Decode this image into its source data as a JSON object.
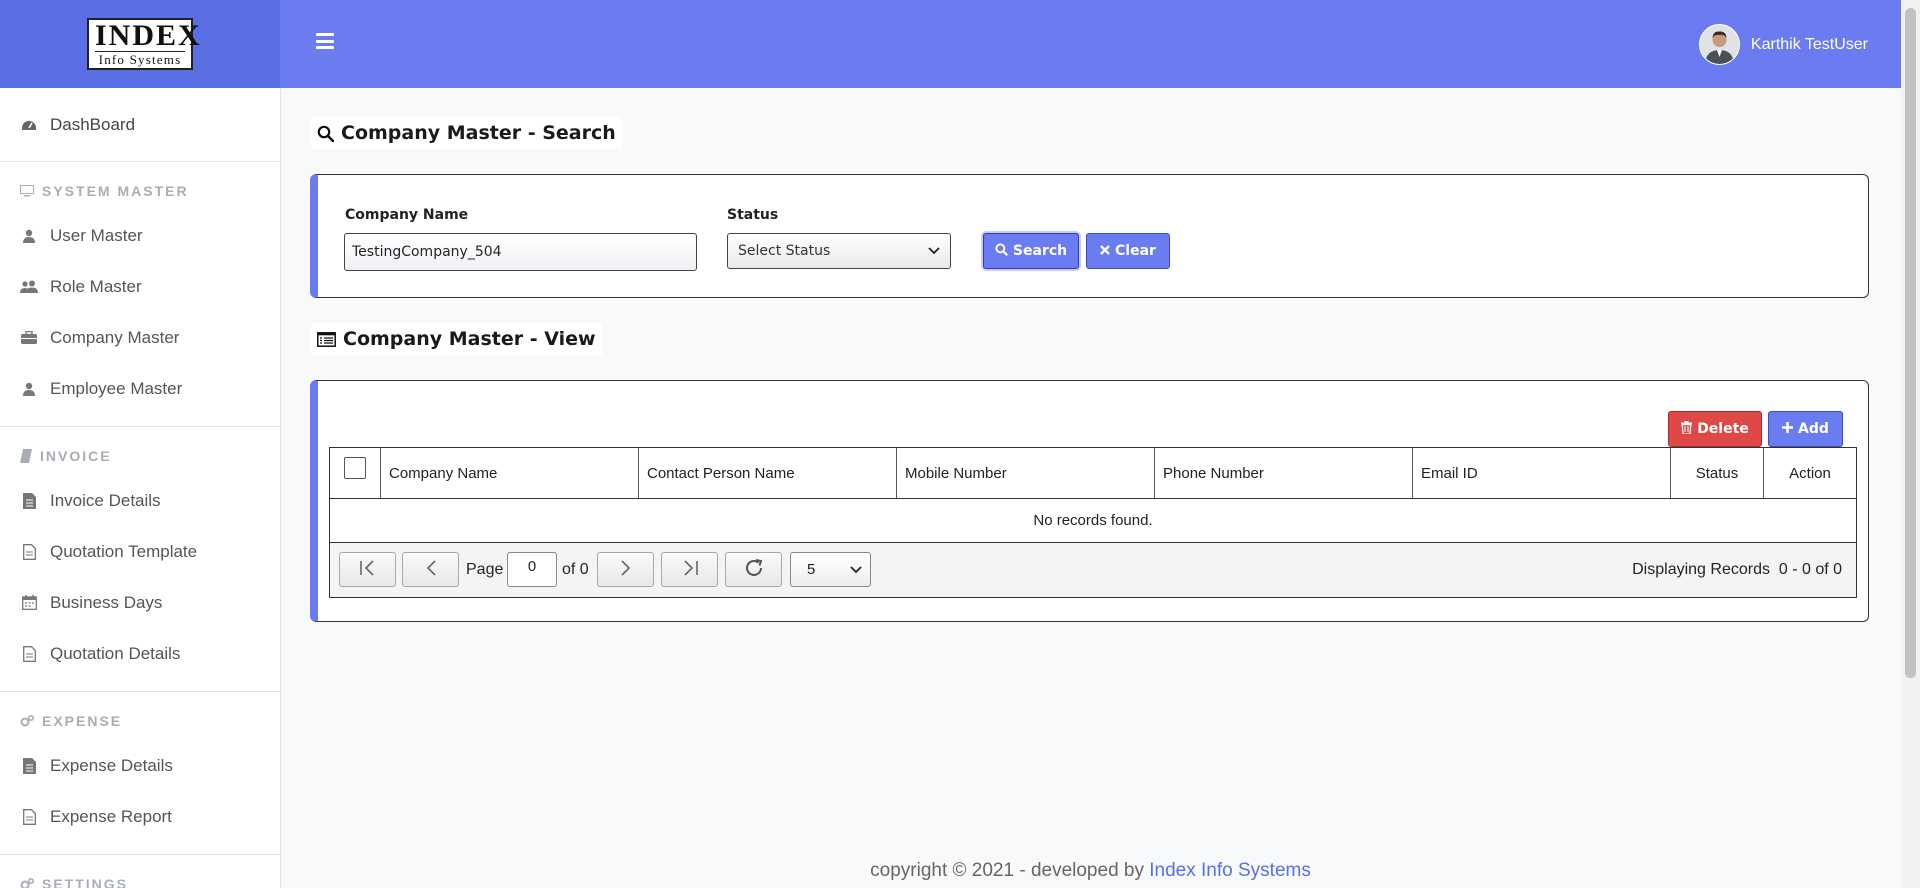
{
  "app": {
    "logo_main": "INDEX",
    "logo_sub": "Info Systems",
    "user_name": "Karthik TestUser"
  },
  "sidebar": {
    "dashboard": "DashBoard",
    "sections": [
      {
        "title": "SYSTEM MASTER",
        "icon": "monitor-icon",
        "items": [
          {
            "label": "User Master",
            "icon": "user-icon"
          },
          {
            "label": "Role Master",
            "icon": "users-icon"
          },
          {
            "label": "Company Master",
            "icon": "briefcase-icon"
          },
          {
            "label": "Employee Master",
            "icon": "user-icon"
          }
        ]
      },
      {
        "title": "INVOICE",
        "icon": "book-icon",
        "items": [
          {
            "label": "Invoice Details",
            "icon": "file-text-icon"
          },
          {
            "label": "Quotation Template",
            "icon": "file-icon"
          },
          {
            "label": "Business Days",
            "icon": "calendar-icon"
          },
          {
            "label": "Quotation Details",
            "icon": "file-icon"
          }
        ]
      },
      {
        "title": "EXPENSE",
        "icon": "gears-icon",
        "items": [
          {
            "label": "Expense Details",
            "icon": "file-text-icon"
          },
          {
            "label": "Expense Report",
            "icon": "file-icon"
          }
        ]
      },
      {
        "title": "SETTINGS",
        "icon": "gears-icon",
        "items": []
      }
    ]
  },
  "search": {
    "title": "Company Master - Search",
    "company_label": "Company Name",
    "company_value": "TestingCompany_504",
    "status_label": "Status",
    "status_value": "Select Status",
    "search_btn": "Search",
    "clear_btn": "Clear"
  },
  "view": {
    "title": "Company Master - View",
    "delete_btn": "Delete",
    "add_btn": "Add",
    "columns": [
      "Company Name",
      "Contact Person Name",
      "Mobile Number",
      "Phone Number",
      "Email ID",
      "Status",
      "Action"
    ],
    "empty_message": "No records found.",
    "pager": {
      "page_label": "Page",
      "page_value": "0",
      "of_label": "of 0",
      "page_size": "5",
      "records_text": "Displaying Records  0 - 0 of 0"
    }
  },
  "footer": {
    "text": "copyright © 2021 - developed by ",
    "link": "Index Info Systems"
  },
  "colors": {
    "header": "#6b7cf0",
    "sidebar_header": "#5a6fe3",
    "danger": "#e04848"
  }
}
